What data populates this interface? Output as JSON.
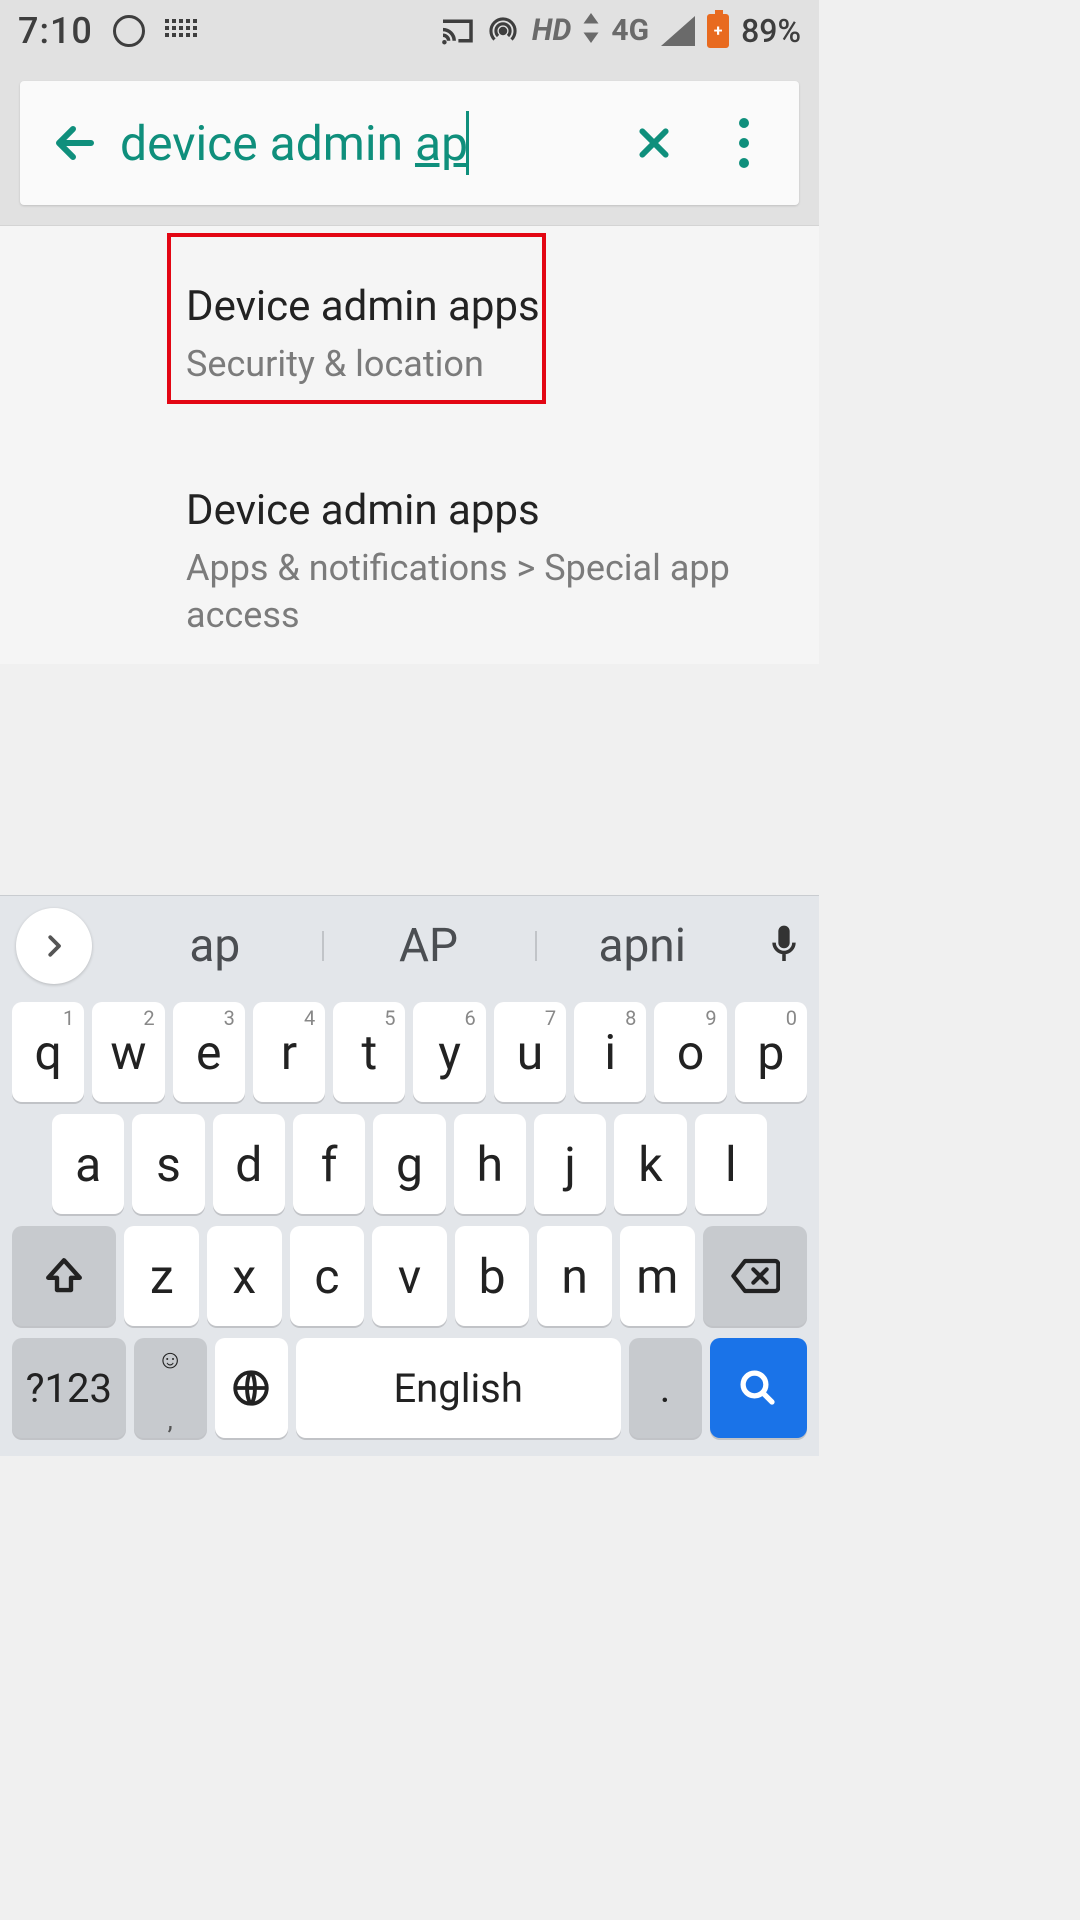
{
  "status": {
    "time": "7:10",
    "network_label": "HD",
    "network_type": "4G",
    "battery_pct": "89%"
  },
  "search": {
    "query_prefix": "device admin ",
    "query_underlined": "ap"
  },
  "results": [
    {
      "title": "Device admin apps",
      "subtitle": "Security & location"
    },
    {
      "title": "Device admin apps",
      "subtitle": "Apps & notifications > Special app access"
    }
  ],
  "suggestions": [
    "ap",
    "AP",
    "apni"
  ],
  "keyboard": {
    "row1": [
      {
        "k": "q",
        "h": "1"
      },
      {
        "k": "w",
        "h": "2"
      },
      {
        "k": "e",
        "h": "3"
      },
      {
        "k": "r",
        "h": "4"
      },
      {
        "k": "t",
        "h": "5"
      },
      {
        "k": "y",
        "h": "6"
      },
      {
        "k": "u",
        "h": "7"
      },
      {
        "k": "i",
        "h": "8"
      },
      {
        "k": "o",
        "h": "9"
      },
      {
        "k": "p",
        "h": "0"
      }
    ],
    "row2": [
      "a",
      "s",
      "d",
      "f",
      "g",
      "h",
      "j",
      "k",
      "l"
    ],
    "row3": [
      "z",
      "x",
      "c",
      "v",
      "b",
      "n",
      "m"
    ],
    "symbols_label": "?123",
    "space_label": "English",
    "period_label": ".",
    "comma_label": ","
  }
}
